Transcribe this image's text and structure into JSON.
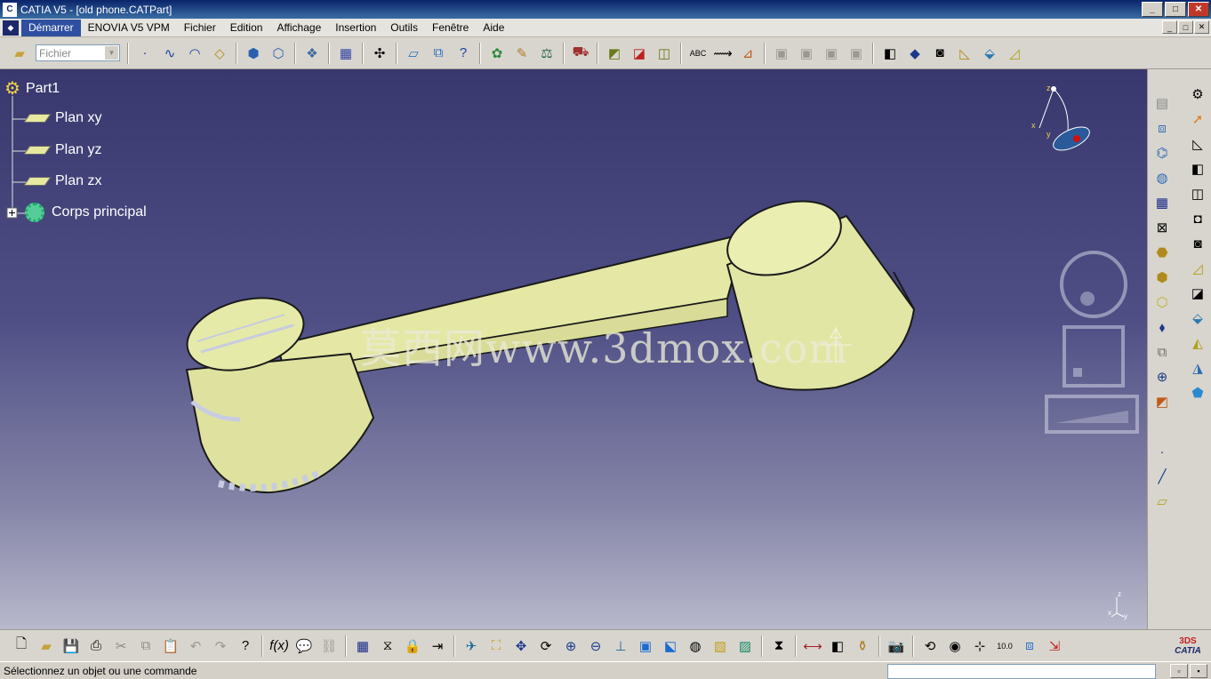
{
  "window": {
    "title": "CATIA V5 - [old phone.CATPart]",
    "app_icon_label": "C",
    "minimize_label": "_",
    "maximize_label": "□",
    "close_label": "✕"
  },
  "menubar": {
    "items": [
      "Démarrer",
      "ENOVIA V5 VPM",
      "Fichier",
      "Edition",
      "Affichage",
      "Insertion",
      "Outils",
      "Fenêtre",
      "Aide"
    ],
    "active": "Démarrer",
    "doc_buttons": [
      "_",
      "□",
      "✕"
    ]
  },
  "toolbar_top": {
    "file_select": {
      "value": "Fichier"
    }
  },
  "tree": {
    "root": "Part1",
    "children": [
      "Plan xy",
      "Plan yz",
      "Plan zx",
      "Corps principal"
    ]
  },
  "compass": {
    "axis_x": "x",
    "axis_y": "y",
    "axis_z": "z"
  },
  "axis_indicator": {
    "x": "x",
    "y": "y",
    "z": "z"
  },
  "watermark": "莫西网www.3dmox.com",
  "brand": {
    "text": "CATIA",
    "logo": "3DS"
  },
  "status": {
    "message": "Sélectionnez un objet ou une commande"
  },
  "colors": {
    "viewport_top": "#38386e",
    "viewport_bottom": "#b8b8cc",
    "model_fill": "#e8eca6",
    "model_edge": "#1a1a1a",
    "titlebar": "#0a246a"
  },
  "icons": {
    "top": [
      "folder-open-icon",
      "point-icon",
      "spline-icon",
      "circle-arc-icon",
      "sketch-icon",
      "pad-icon",
      "pocket-icon",
      "shaft-icon",
      "pattern-icon",
      "axis-icon",
      "plane-icon",
      "boolean-icon",
      "help-icon",
      "catalog-icon",
      "knowledge-icon",
      "law-icon",
      "analysis-icon",
      "render-icon",
      "apply-material-icon",
      "material-icon",
      "texture-icon",
      "spell-check-icon",
      "measure-icon",
      "annotation-icon",
      "grey-tool-1-icon",
      "grey-tool-2-icon",
      "grey-tool-3-icon",
      "grey-tool-4-icon",
      "solid-icon",
      "sweep-icon",
      "shell-icon",
      "fill-icon",
      "block-icon",
      "surface-icon"
    ],
    "bottom": [
      "new-icon",
      "open-icon",
      "save-icon",
      "print-icon",
      "cut-icon",
      "copy-icon",
      "paste-icon",
      "undo-icon",
      "redo-icon",
      "whats-this-icon",
      "formula-icon",
      "comment-icon",
      "link-icon",
      "table-icon",
      "tree-icon",
      "lock-icon",
      "export-icon",
      "fly-icon",
      "fit-all-icon",
      "pan-icon",
      "rotate-icon",
      "zoom-in-icon",
      "zoom-out-icon",
      "normal-view-icon",
      "iso-view-icon",
      "view-cube-icon",
      "hide-show-icon",
      "swap-icon",
      "shading-icon",
      "render-style-icon",
      "measure-between-icon",
      "measure-item-icon",
      "inertia-icon",
      "capture-icon",
      "refresh-icon",
      "compass-icon",
      "axis-icon",
      "units-icon",
      "coords-icon",
      "update-icon"
    ],
    "right_a": [
      "hole-icon",
      "copy-paste-icon",
      "dress-up-icon",
      "thread-icon",
      "grid-icon",
      "symmetry-icon",
      "pad-icon",
      "rib-icon",
      "edge-fillet-icon",
      "chamfer-icon",
      "draft-icon",
      "thickness-icon",
      "target-icon",
      "cube-icon",
      "point-icon",
      "line-icon",
      "plane-icon"
    ],
    "right_b": [
      "settings-icon",
      "select-arrow-icon",
      "sketcher-icon",
      "pocket-icon",
      "groove-icon",
      "hole-icon",
      "shell-icon",
      "shaft-icon",
      "split-icon",
      "sew-icon",
      "thicken-icon",
      "surface-icon",
      "remove-face-icon"
    ]
  }
}
